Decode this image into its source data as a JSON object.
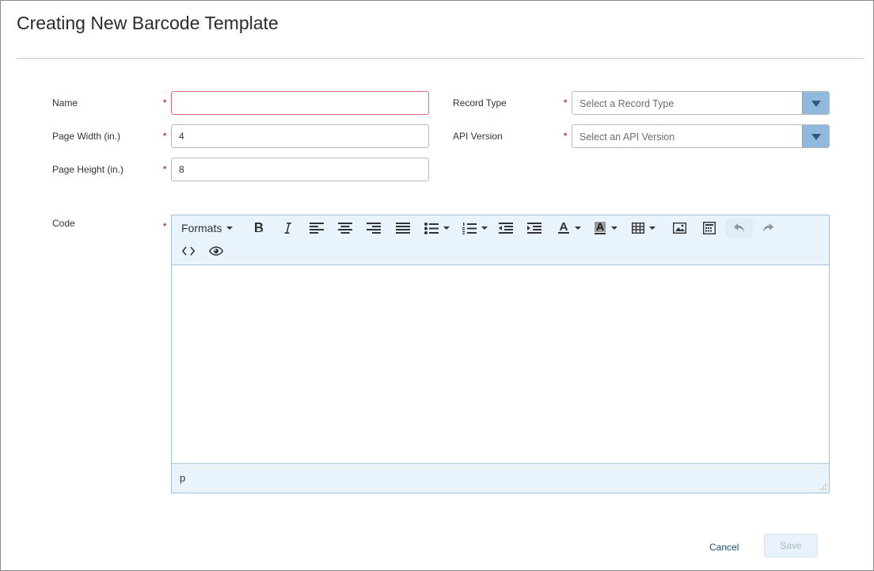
{
  "page": {
    "title": "Creating New Barcode Template"
  },
  "form": {
    "name": {
      "label": "Name",
      "required": "*",
      "value": ""
    },
    "page_width": {
      "label": "Page Width (in.)",
      "required": "*",
      "value": "4"
    },
    "page_height": {
      "label": "Page Height (in.)",
      "required": "*",
      "value": "8"
    },
    "record_type": {
      "label": "Record Type",
      "required": "*",
      "placeholder": "Select a Record Type"
    },
    "api_version": {
      "label": "API Version",
      "required": "*",
      "placeholder": "Select an API Version"
    },
    "code": {
      "label": "Code",
      "required": "*"
    }
  },
  "editor": {
    "formats_label": "Formats",
    "toolbar_icons": [
      "bold-icon",
      "italic-icon",
      "align-left-icon",
      "align-center-icon",
      "align-right-icon",
      "align-justify-icon",
      "bullet-list-icon",
      "numbered-list-icon",
      "outdent-icon",
      "indent-icon",
      "text-color-icon",
      "background-color-icon",
      "table-icon",
      "image-icon",
      "template-icon",
      "undo-icon",
      "redo-icon",
      "source-code-icon",
      "preview-icon"
    ],
    "status_path": "p"
  },
  "actions": {
    "cancel_label": "Cancel",
    "save_label": "Save"
  },
  "colors": {
    "required": "#c23934",
    "select_button": "#90b9db",
    "toolbar_bg": "#e9f3fc",
    "link": "#1a4f7d"
  }
}
